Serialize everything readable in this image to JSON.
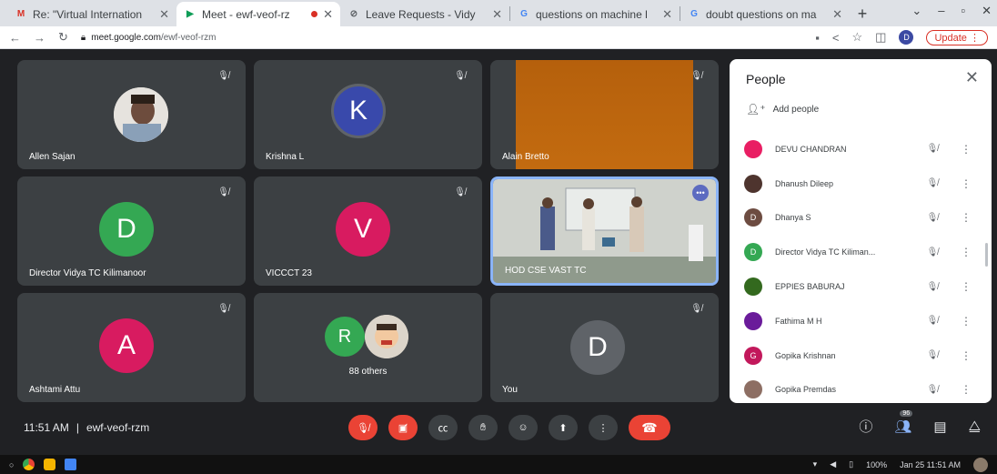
{
  "browser": {
    "tabs": [
      {
        "favicon": "M",
        "favicon_color": "#d93025",
        "title": "Re: \"Virtual Internation",
        "active": false
      },
      {
        "favicon": "▶",
        "favicon_color": "#0f9d58",
        "title": "Meet - ewf-veof-rz",
        "active": true,
        "recording": true
      },
      {
        "favicon": "⊘",
        "favicon_color": "#5f6368",
        "title": "Leave Requests - Vidy",
        "active": false
      },
      {
        "favicon": "G",
        "favicon_color": "#4285f4",
        "title": "questions on machine l",
        "active": false
      },
      {
        "favicon": "G",
        "favicon_color": "#4285f4",
        "title": "doubt questions on ma",
        "active": false
      }
    ],
    "new_tab": "+",
    "url_host": "meet.google.com",
    "url_path": "/ewf-veof-rzm",
    "profile_initial": "D",
    "update_label": "Update"
  },
  "tiles": [
    {
      "name": "Allen Sajan",
      "type": "photo"
    },
    {
      "name": "Krishna L",
      "type": "initial",
      "initial": "K",
      "color": "#3949ab"
    },
    {
      "name": "Alain Bretto",
      "type": "video-orange"
    },
    {
      "name": "Director Vidya TC Kilimanoor",
      "type": "initial",
      "initial": "D",
      "color": "#34a853"
    },
    {
      "name": "VICCCT 23",
      "type": "initial",
      "initial": "V",
      "color": "#d81b60"
    },
    {
      "name": "HOD CSE VAST TC",
      "type": "video-room"
    },
    {
      "name": "Ashtami Attu",
      "type": "initial",
      "initial": "A",
      "color": "#d81b60"
    },
    {
      "name": "88 others",
      "type": "others",
      "initial": "R",
      "color": "#34a853"
    },
    {
      "name": "You",
      "type": "initial",
      "initial": "D",
      "color": "#5f6368"
    }
  ],
  "people_panel": {
    "title": "People",
    "add_people": "Add people",
    "participants": [
      {
        "name": "DEVU CHANDRAN",
        "initial": "",
        "color": "#e91e63"
      },
      {
        "name": "Dhanush Dileep",
        "initial": "",
        "color": "#4e342e"
      },
      {
        "name": "Dhanya S",
        "initial": "D",
        "color": "#6d4c41"
      },
      {
        "name": "Director Vidya TC Kiliman...",
        "initial": "D",
        "color": "#34a853"
      },
      {
        "name": "EPPIES BABURAJ",
        "initial": "",
        "color": "#33691e"
      },
      {
        "name": "Fathima M H",
        "initial": "",
        "color": "#6a1b9a"
      },
      {
        "name": "Gopika Krishnan",
        "initial": "G",
        "color": "#c2185b"
      },
      {
        "name": "Gopika Premdas",
        "initial": "",
        "color": "#8d6e63"
      }
    ]
  },
  "meeting": {
    "time": "11:51 AM",
    "separator": "|",
    "code": "ewf-veof-rzm",
    "participant_count": "96"
  },
  "taskbar": {
    "battery": "100%",
    "datetime": "Jan 25 11:51 AM"
  }
}
